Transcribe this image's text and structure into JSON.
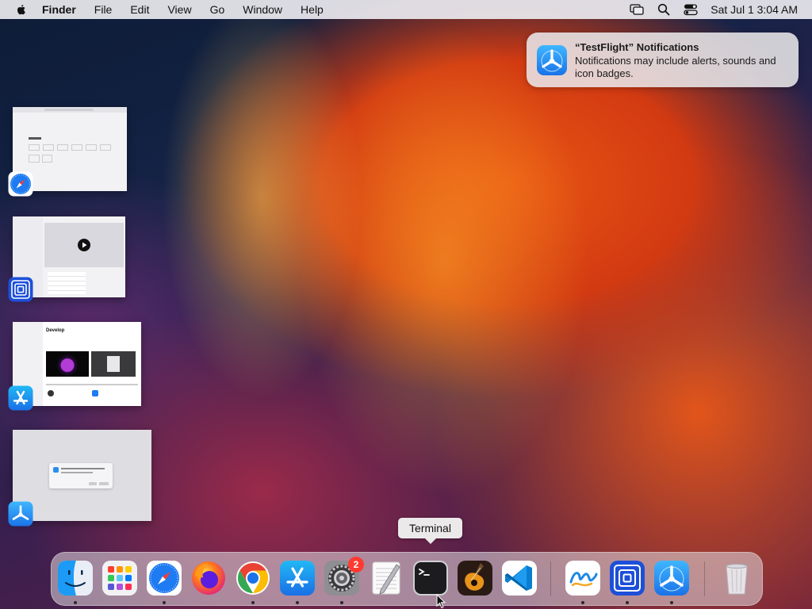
{
  "menubar": {
    "app_name": "Finder",
    "menus": [
      "File",
      "Edit",
      "View",
      "Go",
      "Window",
      "Help"
    ],
    "clock": "Sat Jul 1  3:04 AM",
    "status_icons": [
      "screen-mirroring-icon",
      "spotlight-search-icon",
      "control-center-icon"
    ]
  },
  "notification": {
    "title": "“TestFlight” Notifications",
    "body": "Notifications may include alerts, sounds and icon badges.",
    "icon": "testflight-icon"
  },
  "stage_manager": {
    "windows": [
      {
        "app": "Safari",
        "icon": "safari-icon"
      },
      {
        "app": "Simulator",
        "icon": "simulator-icon"
      },
      {
        "app": "App Store",
        "icon": "app-store-icon"
      },
      {
        "app": "TestFlight",
        "icon": "testflight-icon"
      }
    ],
    "appstore_thumb_heading": "Develop"
  },
  "dock": {
    "tooltip": "Terminal",
    "badge_count": "2",
    "items": [
      {
        "name": "Finder",
        "icon": "finder-icon",
        "running": true
      },
      {
        "name": "Launchpad",
        "icon": "launchpad-icon",
        "running": false
      },
      {
        "name": "Safari",
        "icon": "safari-icon",
        "running": true
      },
      {
        "name": "Firefox",
        "icon": "firefox-icon",
        "running": false
      },
      {
        "name": "Google Chrome",
        "icon": "chrome-icon",
        "running": true
      },
      {
        "name": "App Store",
        "icon": "app-store-icon",
        "running": true
      },
      {
        "name": "System Settings",
        "icon": "system-settings-icon",
        "running": true
      },
      {
        "name": "TextEdit",
        "icon": "textedit-icon",
        "running": false
      },
      {
        "name": "Terminal",
        "icon": "terminal-icon",
        "running": false
      },
      {
        "name": "GarageBand",
        "icon": "garageband-icon",
        "running": false
      },
      {
        "name": "Visual Studio Code",
        "icon": "vscode-icon",
        "running": false
      },
      {
        "name": "Freeform",
        "icon": "freeform-icon",
        "running": true
      },
      {
        "name": "Simulator",
        "icon": "simulator-icon",
        "running": true
      },
      {
        "name": "TestFlight",
        "icon": "testflight-icon",
        "running": true
      },
      {
        "name": "Trash",
        "icon": "trash-icon",
        "running": false
      }
    ]
  },
  "colors": {
    "accent_blue": "#1e7bf2",
    "badge_red": "#ff3b30"
  }
}
